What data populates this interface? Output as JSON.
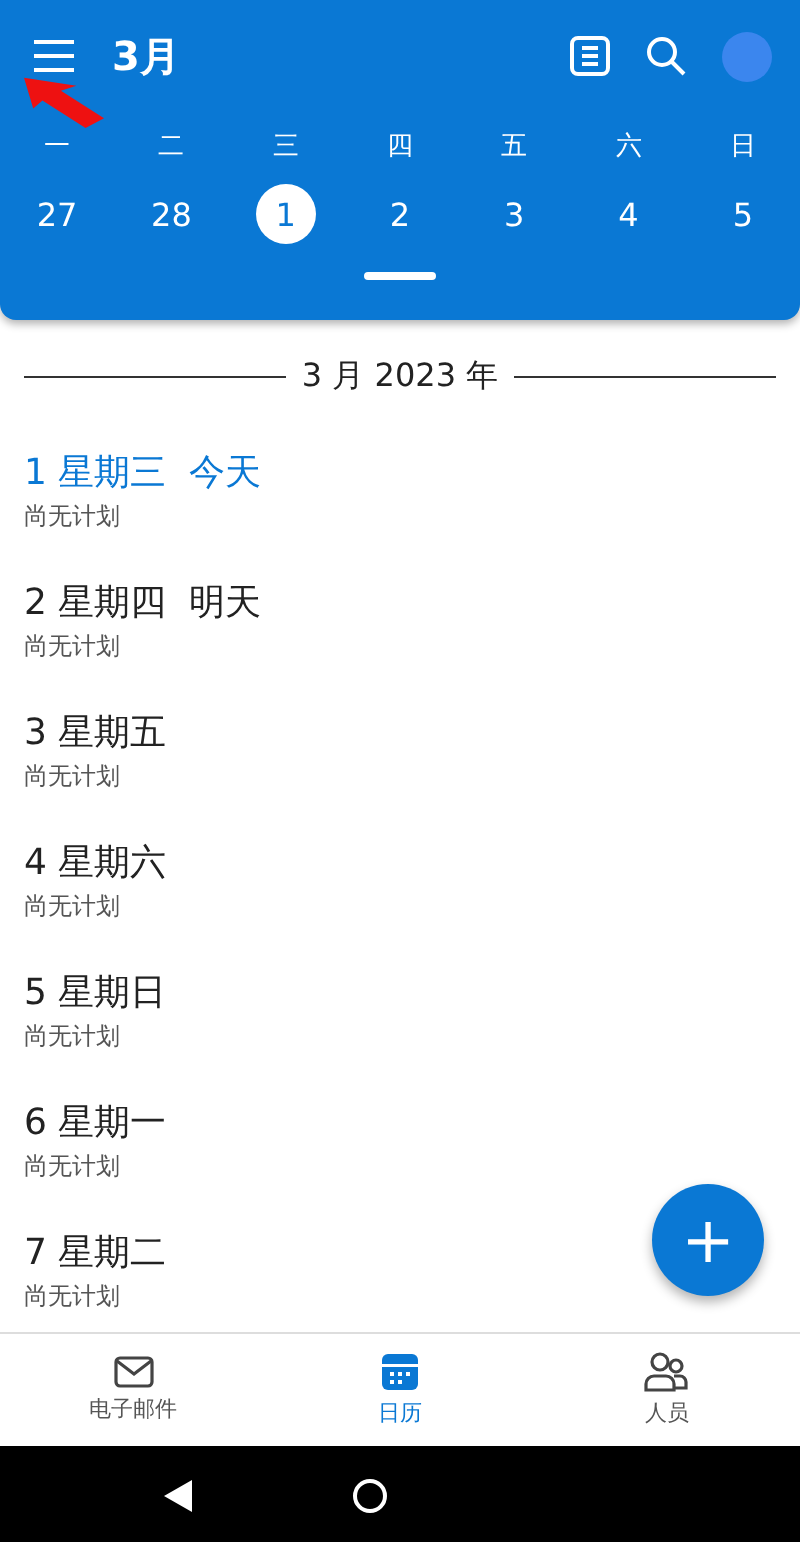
{
  "header": {
    "title": "3月"
  },
  "weekdays": [
    "一",
    "二",
    "三",
    "四",
    "五",
    "六",
    "日"
  ],
  "dates": [
    {
      "label": "27",
      "selected": false
    },
    {
      "label": "28",
      "selected": false
    },
    {
      "label": "1",
      "selected": true
    },
    {
      "label": "2",
      "selected": false
    },
    {
      "label": "3",
      "selected": false
    },
    {
      "label": "4",
      "selected": false
    },
    {
      "label": "5",
      "selected": false
    }
  ],
  "month_heading": "3 月 2023 年",
  "agenda": [
    {
      "day": "1 星期三  今天",
      "note": "尚无计划",
      "today": true
    },
    {
      "day": "2 星期四  明天",
      "note": "尚无计划",
      "today": false
    },
    {
      "day": "3 星期五",
      "note": "尚无计划",
      "today": false
    },
    {
      "day": "4 星期六",
      "note": "尚无计划",
      "today": false
    },
    {
      "day": "5 星期日",
      "note": "尚无计划",
      "today": false
    },
    {
      "day": "6 星期一",
      "note": "尚无计划",
      "today": false
    },
    {
      "day": "7 星期二",
      "note": "尚无计划",
      "today": false
    }
  ],
  "fab": {
    "label": "+"
  },
  "bottom_tabs": [
    {
      "label": "电子邮件",
      "kind": "mail",
      "selected": false
    },
    {
      "label": "日历",
      "kind": "calendar",
      "selected": true
    },
    {
      "label": "人员",
      "kind": "people",
      "selected": false
    }
  ]
}
